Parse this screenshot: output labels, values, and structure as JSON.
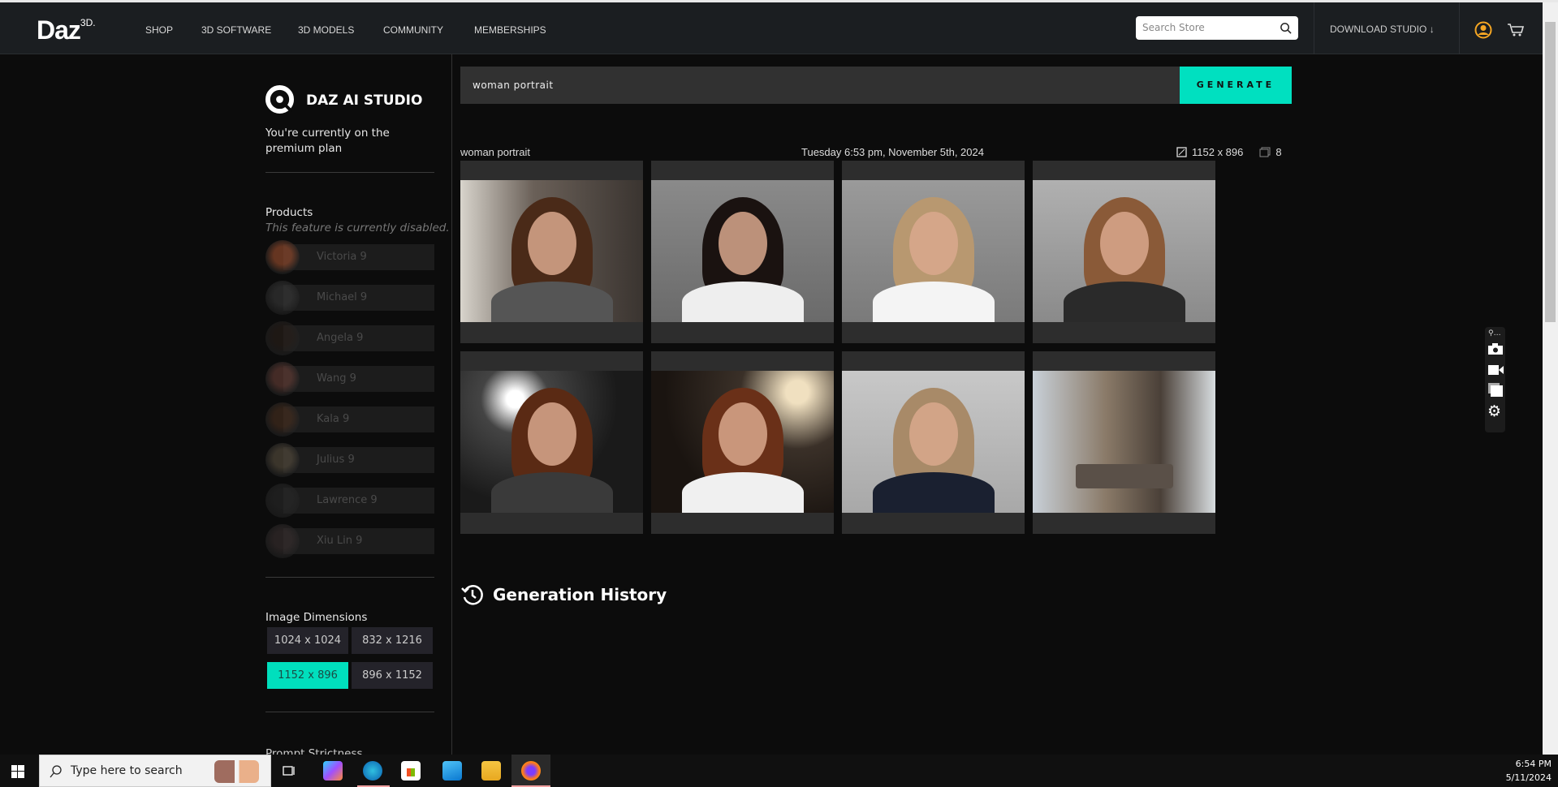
{
  "nav": {
    "logo": "Daz",
    "logo_sup": "3D.",
    "items": [
      "SHOP",
      "3D SOFTWARE",
      "3D MODELS",
      "COMMUNITY",
      "MEMBERSHIPS"
    ],
    "search_placeholder": "Search Store",
    "download": "DOWNLOAD STUDIO"
  },
  "sidebar": {
    "title": "DAZ AI STUDIO",
    "plan": "You're currently on the premium plan",
    "products_label": "Products",
    "products_note": "This feature is currently disabled.",
    "products": [
      "Victoria 9",
      "Michael 9",
      "Angela 9",
      "Wang 9",
      "Kala 9",
      "Julius 9",
      "Lawrence 9",
      "Xiu Lin 9"
    ],
    "dims_label": "Image Dimensions",
    "dims": [
      "1024 x 1024",
      "832 x 1216",
      "1152 x 896",
      "896 x 1152"
    ],
    "dims_selected": "1152 x 896",
    "next_section": "Prompt Strictness"
  },
  "main": {
    "prompt": "woman portrait",
    "generate": "GENERATE",
    "result": {
      "prompt": "woman portrait",
      "timestamp": "Tuesday 6:53 pm, November 5th, 2024",
      "dimensions": "1152 x 896",
      "count": "8"
    },
    "history_title": "Generation History"
  },
  "colors": {
    "accent": "#00e0c0",
    "nav_bg": "#1b1e21",
    "page_bg": "#0c0c0c",
    "user_icon": "#f5a623"
  },
  "taskbar": {
    "search_placeholder": "Type here to search",
    "time": "6:54 PM",
    "date": "5/11/2024"
  }
}
